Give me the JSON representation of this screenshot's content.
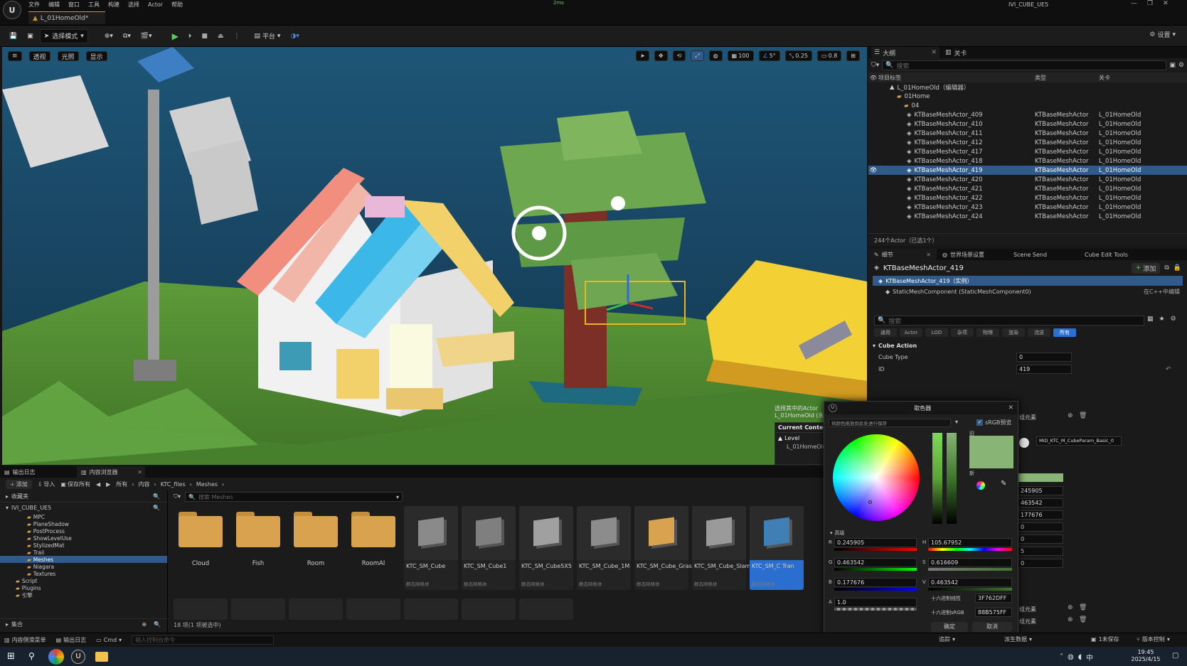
{
  "window": {
    "menu": [
      "文件",
      "编辑",
      "窗口",
      "工具",
      "构建",
      "选择",
      "Actor",
      "帮助"
    ],
    "project_name": "IVI_CUBE_UE5",
    "net_indicator": "2ms",
    "level_tab": "L_01HomeOld*"
  },
  "toolbar": {
    "select_mode": "选择模式",
    "platform": "平台",
    "settings": "设置"
  },
  "viewport": {
    "left_buttons": [
      "透视",
      "光照",
      "显示"
    ],
    "grid_value": "100",
    "angle_value": "5°",
    "scale_value": "0.25",
    "camera_speed": "0.8",
    "context": {
      "line1": "选择其中的Actor",
      "line2": "L_01HomeOld (永",
      "title": "Current Context",
      "level_label": "Level",
      "level_name": "L_01HomeOld"
    }
  },
  "outliner": {
    "tab_label": "大纲",
    "tab2_label": "关卡",
    "search_placeholder": "搜索",
    "columns": [
      "项目标签",
      "类型",
      "关卡"
    ],
    "tree": [
      {
        "label": "L_01HomeOld（编辑器）",
        "indent": 0
      },
      {
        "label": "01Home",
        "indent": 1
      },
      {
        "label": "04",
        "indent": 2
      }
    ],
    "rows": [
      {
        "label": "KTBaseMeshActor_409",
        "type": "KTBaseMeshActor",
        "level": "L_01HomeOld"
      },
      {
        "label": "KTBaseMeshActor_410",
        "type": "KTBaseMeshActor",
        "level": "L_01HomeOld"
      },
      {
        "label": "KTBaseMeshActor_411",
        "type": "KTBaseMeshActor",
        "level": "L_01HomeOld"
      },
      {
        "label": "KTBaseMeshActor_412",
        "type": "KTBaseMeshActor",
        "level": "L_01HomeOld"
      },
      {
        "label": "KTBaseMeshActor_417",
        "type": "KTBaseMeshActor",
        "level": "L_01HomeOld"
      },
      {
        "label": "KTBaseMeshActor_418",
        "type": "KTBaseMeshActor",
        "level": "L_01HomeOld"
      },
      {
        "label": "KTBaseMeshActor_419",
        "type": "KTBaseMeshActor",
        "level": "L_01HomeOld",
        "selected": true
      },
      {
        "label": "KTBaseMeshActor_420",
        "type": "KTBaseMeshActor",
        "level": "L_01HomeOld"
      },
      {
        "label": "KTBaseMeshActor_421",
        "type": "KTBaseMeshActor",
        "level": "L_01HomeOld"
      },
      {
        "label": "KTBaseMeshActor_422",
        "type": "KTBaseMeshActor",
        "level": "L_01HomeOld"
      },
      {
        "label": "KTBaseMeshActor_423",
        "type": "KTBaseMeshActor",
        "level": "L_01HomeOld"
      },
      {
        "label": "KTBaseMeshActor_424",
        "type": "KTBaseMeshActor",
        "level": "L_01HomeOld"
      }
    ],
    "footer": "244个Actor（已选1个）"
  },
  "details": {
    "tabs": [
      "细节",
      "世界场景设置",
      "Scene Send",
      "Cube Edit Tools"
    ],
    "actor_name": "KTBaseMeshActor_419",
    "add_button": "添加",
    "instance_label": "KTBaseMeshActor_419（实例）",
    "component_label": "StaticMeshComponent (StaticMeshComponent0)",
    "edit_in_cpp": "在C++中编辑",
    "search_placeholder": "搜索",
    "filter_tabs": [
      "通用",
      "Actor",
      "LOD",
      "杂项",
      "物理",
      "渲染",
      "流送",
      "所有"
    ],
    "section": "Cube Action",
    "props": [
      {
        "name": "Cube Type",
        "value": "0"
      },
      {
        "name": "ID",
        "value": "419"
      }
    ],
    "elements_label": "组元素",
    "material_name": "MID_KTC_M_CubeParam_Basic_0",
    "partial_values": [
      "245905",
      "463542",
      "177676",
      "0",
      "0",
      "5",
      "0"
    ]
  },
  "content_browser": {
    "tab_output": "输出日志",
    "tab_content": "内容浏览器",
    "add_button": "添加",
    "import_button": "导入",
    "save_all_button": "保存所有",
    "breadcrumb": [
      "所有",
      "内容",
      "KTC_files",
      "Meshes"
    ],
    "favorites": "收藏夹",
    "project_root": "IVI_CUBE_UE5",
    "search_placeholder": "搜索 Meshes",
    "tree": [
      "MPC",
      "PlaneShadow",
      "PostProcess",
      "ShowLevelUse",
      "StylizedMat",
      "Trail",
      "Meshes",
      "Niagara",
      "Textures",
      "Script",
      "Plugins",
      "引擎"
    ],
    "collections": "集合",
    "folders": [
      "Cloud",
      "Fish",
      "Room",
      "RoomAl"
    ],
    "assets": [
      {
        "name": "KTC_SM_Cube",
        "type": "静态网格体"
      },
      {
        "name": "KTC_SM_Cube1",
        "type": "静态网格体"
      },
      {
        "name": "KTC_SM_Cube5X5",
        "type": "静态网格体"
      },
      {
        "name": "KTC_SM_Cube_1M",
        "type": "静态网格体"
      },
      {
        "name": "KTC_SM_Cube_Grass",
        "type": "静态网格体"
      },
      {
        "name": "KTC_SM_Cube_Slam",
        "type": "静态网格体"
      },
      {
        "name": "KTC_SM_C Tran",
        "type": "静态网格体"
      }
    ],
    "status": "18 项(1 项被选中)"
  },
  "color_picker": {
    "title": "取色器",
    "hint": "将颜色拖放到此处进行保存",
    "srgb_label": "sRGB预览",
    "old_label": "旧",
    "new_label": "新",
    "advanced": "高级",
    "R": "0.245905",
    "G": "0.463542",
    "B": "0.177676",
    "A": "1.0",
    "H": "105.67952",
    "S": "0.616609",
    "V": "0.463542",
    "hex_linear_label": "十六进制线性",
    "hex_linear": "3F762DFF",
    "hex_srgb_label": "十六进制sRGB",
    "hex_srgb": "88B575FF",
    "ok": "确定",
    "cancel": "取消",
    "swatch_color": "#88B575"
  },
  "statusbar": {
    "content_drawer": "内容侧滑菜单",
    "output_log": "输出日志",
    "cmd": "Cmd",
    "cmd_placeholder": "输入控制台命令",
    "unsaved": "1未保存",
    "source_control": "版本控制",
    "trace": "追踪",
    "derived_data": "派生数据"
  },
  "taskbar": {
    "time": "19:45",
    "date": "2025/4/15"
  }
}
